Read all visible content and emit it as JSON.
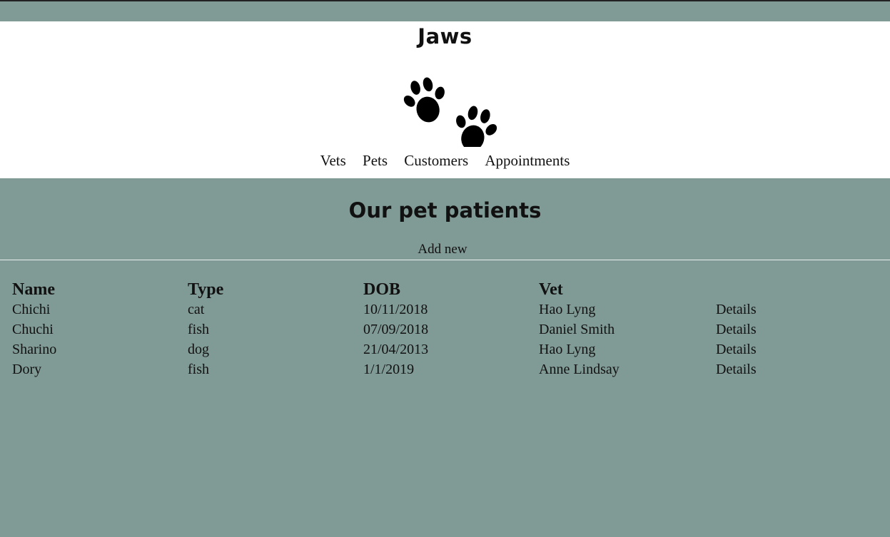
{
  "site": {
    "title": "Jaws"
  },
  "nav": {
    "items": [
      "Vets",
      "Pets",
      "Customers",
      "Appointments"
    ]
  },
  "page": {
    "heading": "Our pet patients",
    "add_new": "Add new"
  },
  "table": {
    "headers": [
      "Name",
      "Type",
      "DOB",
      "Vet"
    ],
    "rows": [
      {
        "name": "Chichi",
        "type": "cat",
        "dob": "10/11/2018",
        "vet": "Hao Lyng",
        "action": "Details"
      },
      {
        "name": "Chuchi",
        "type": "fish",
        "dob": "07/09/2018",
        "vet": "Daniel Smith",
        "action": "Details"
      },
      {
        "name": "Sharino",
        "type": "dog",
        "dob": "21/04/2013",
        "vet": "Hao Lyng",
        "action": "Details"
      },
      {
        "name": "Dory",
        "type": "fish",
        "dob": "1/1/2019",
        "vet": "Anne Lindsay",
        "action": "Details"
      }
    ]
  },
  "colors": {
    "background": "#809a95",
    "header_bg": "#ffffff",
    "text": "#111111"
  },
  "icons": {
    "logo": "paw-prints-icon"
  }
}
